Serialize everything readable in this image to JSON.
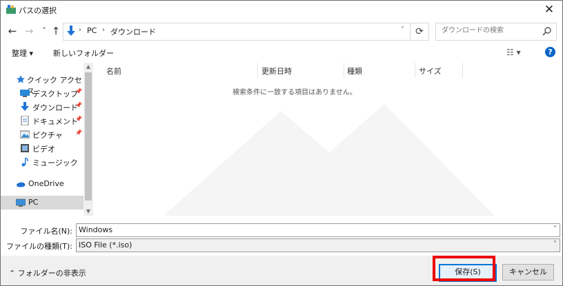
{
  "window": {
    "title": "パスの選択",
    "close_glyph": "✕"
  },
  "nav": {
    "back": "←",
    "forward": "→",
    "recent": "˅",
    "up": "↑"
  },
  "address": {
    "sep1": "›",
    "crumbs": [
      "PC",
      "ダウンロード"
    ],
    "sep2": "›",
    "dropdown": "˅",
    "refresh": "⟳"
  },
  "search": {
    "placeholder": "ダウンロードの検索"
  },
  "toolbar": {
    "organize": "整理 ▾",
    "new_folder": "新しいフォルダー",
    "view": "☷ ▾",
    "help": "?"
  },
  "sidebar": {
    "items": [
      {
        "label": "クイック アクセス",
        "icon": "star-icon"
      },
      {
        "label": "デスクトップ",
        "icon": "desktop-icon",
        "pinned": true
      },
      {
        "label": "ダウンロード",
        "icon": "download-icon",
        "pinned": true
      },
      {
        "label": "ドキュメント",
        "icon": "document-icon",
        "pinned": true
      },
      {
        "label": "ピクチャ",
        "icon": "pictures-icon",
        "pinned": true
      },
      {
        "label": "ビデオ",
        "icon": "video-icon"
      },
      {
        "label": "ミュージック",
        "icon": "music-icon"
      },
      {
        "label": "OneDrive",
        "icon": "cloud-icon"
      },
      {
        "label": "PC",
        "icon": "computer-icon",
        "selected": true
      }
    ],
    "pin_glyph": "📌"
  },
  "columns": {
    "name": "名前",
    "modified": "更新日時",
    "type": "種類",
    "size": "サイズ"
  },
  "empty_message": "検索条件に一致する項目はありません。",
  "filename": {
    "label": "ファイル名(N):",
    "value": "Windows"
  },
  "filetype": {
    "label": "ファイルの種類(T):",
    "value": "ISO File (*.iso)"
  },
  "footer": {
    "hide_folders": "⌃  フォルダーの非表示",
    "save": "保存(S)",
    "cancel": "キャンセル"
  },
  "colors": {
    "accent": "#0078d7",
    "highlight": "#ee0000",
    "help": "#0a64c8"
  }
}
